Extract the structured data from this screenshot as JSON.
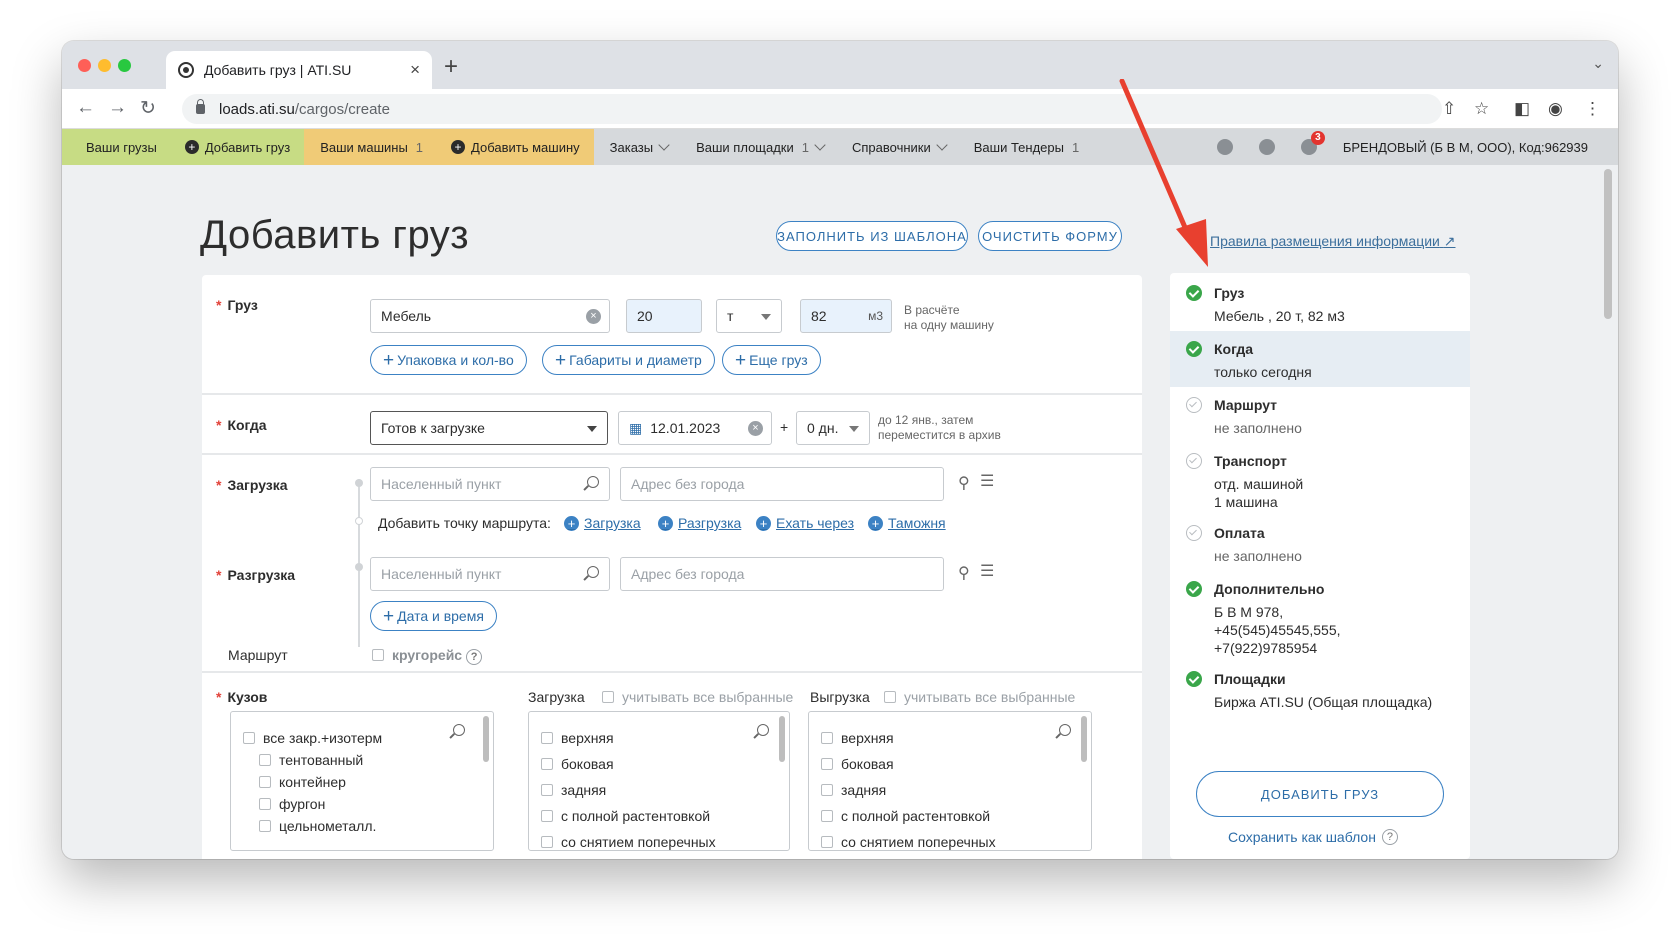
{
  "browser": {
    "tab_title": "Добавить груз | ATI.SU",
    "tab_close": "×",
    "new_tab": "+",
    "url_host": "loads.ati.su",
    "url_path": "/cargos/create"
  },
  "colors": {
    "accent": "#3c82c4",
    "nav_green": "#c7dc84",
    "nav_yellow": "#f0cb77",
    "required_star": "#e2423a",
    "ok_green": "#3aa64a",
    "arrow_red": "#e8402f"
  },
  "sitenav": {
    "your_cargos": "Ваши грузы",
    "add_cargo": "Добавить груз",
    "your_trucks": "Ваши машины",
    "your_trucks_count": "1",
    "add_truck": "Добавить машину",
    "orders": "Заказы",
    "your_platforms": "Ваши площадки",
    "your_platforms_count": "1",
    "directories": "Справочники",
    "your_tenders": "Ваши Тендеры",
    "your_tenders_count": "1",
    "notification_count": "3",
    "company": "БРЕНДОВЫЙ (Б В М, ООО),",
    "code": "Код:962939"
  },
  "page": {
    "title": "Добавить груз",
    "fill_from_template": "ЗАПОЛНИТЬ ИЗ ШАБЛОНА",
    "clear_form": "ОЧИСТИТЬ ФОРМУ",
    "rules_link": "Правила размещения информации"
  },
  "form": {
    "cargo": {
      "label": "Груз",
      "name": "Мебель",
      "weight": "20",
      "weight_unit": "т",
      "volume": "82",
      "volume_unit": "м3",
      "note": "В расчёте\nна одну машину",
      "packaging": "Упаковка и кол-во",
      "dimensions": "Габариты и диаметр",
      "more_cargo": "Еще груз"
    },
    "when": {
      "label": "Когда",
      "mode": "Готов к загрузке",
      "date": "12.01.2023",
      "plus": "+",
      "days": "0 дн.",
      "note": "до 12 янв., затем\nпереместится в архив"
    },
    "loading": {
      "label": "Загрузка",
      "city_placeholder": "Населенный пункт",
      "address_placeholder": "Адрес без города"
    },
    "add_route_point": {
      "label": "Добавить точку маршрута:",
      "loading": "Загрузка",
      "unloading": "Разгрузка",
      "via": "Ехать через",
      "customs": "Таможня"
    },
    "unloading": {
      "label": "Разгрузка",
      "city_placeholder": "Населенный пункт",
      "address_placeholder": "Адрес без города",
      "date_time": "Дата и время"
    },
    "route": {
      "label": "Маршрут",
      "round_trip": "кругорейс",
      "help": "?"
    },
    "body": {
      "label": "Кузов",
      "items": [
        "все закр.+изотерм",
        "тентованный",
        "контейнер",
        "фургон",
        "цельнометалл."
      ]
    },
    "load_type": {
      "label": "Загрузка",
      "consider_all": "учитывать все выбранные",
      "items": [
        "верхняя",
        "боковая",
        "задняя",
        "с полной растентовкой",
        "со снятием поперечных"
      ]
    },
    "unload_type": {
      "label": "Выгрузка",
      "consider_all": "учитывать все выбранные",
      "items": [
        "верхняя",
        "боковая",
        "задняя",
        "с полной растентовкой",
        "со снятием поперечных"
      ]
    }
  },
  "summary": {
    "items": [
      {
        "title": "Груз",
        "value": "Мебель , 20 т, 82 м3",
        "status": "ok"
      },
      {
        "title": "Когда",
        "value": "только сегодня",
        "status": "ok"
      },
      {
        "title": "Маршрут",
        "value": "не заполнено",
        "status": "empty"
      },
      {
        "title": "Транспорт",
        "value": "отд. машиной\n1 машина",
        "status": "empty"
      },
      {
        "title": "Оплата",
        "value": "не заполнено",
        "status": "empty"
      },
      {
        "title": "Дополнительно",
        "value": "Б В М 978,\n+45(545)45545,555,\n+7(922)9785954",
        "status": "ok"
      },
      {
        "title": "Площадки",
        "value": "Биржа ATI.SU (Общая площадка)",
        "status": "ok"
      }
    ],
    "add_cargo_button": "ДОБАВИТЬ ГРУЗ",
    "save_template": "Сохранить как шаблон",
    "help": "?"
  }
}
